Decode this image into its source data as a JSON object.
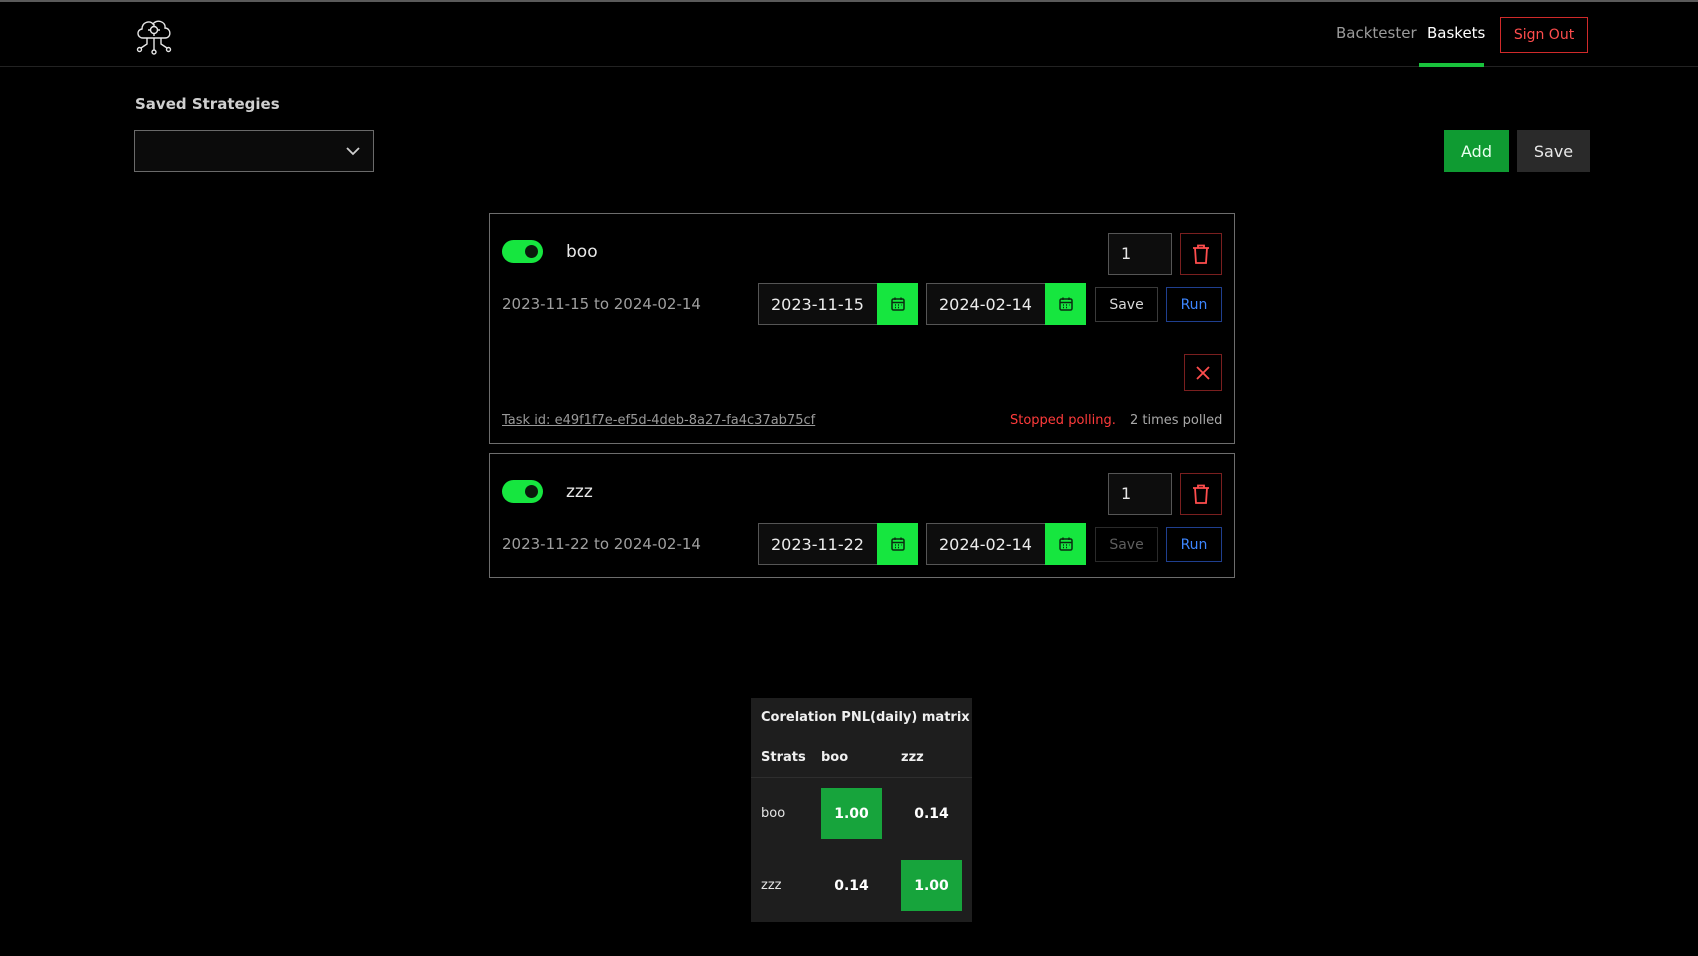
{
  "nav": {
    "links": [
      "Backtester",
      "Baskets"
    ],
    "active": "Baskets",
    "sign_out": "Sign Out"
  },
  "controls": {
    "saved_strategies_label": "Saved Strategies",
    "saved_strategies_value": "",
    "add_label": "Add",
    "save_label": "Save"
  },
  "strategies": [
    {
      "name": "boo",
      "enabled": true,
      "weight": "1",
      "range_text": "2023-11-15 to 2024-02-14",
      "start_date": "2023-11-15",
      "end_date": "2024-02-14",
      "save_label": "Save",
      "run_label": "Run",
      "task_id": "Task id: e49f1f7e-ef5d-4deb-8a27-fa4c37ab75cf",
      "status": "Stopped polling.",
      "poll_count": "2 times polled"
    },
    {
      "name": "zzz",
      "enabled": true,
      "weight": "1",
      "range_text": "2023-11-22 to 2024-02-14",
      "start_date": "2023-11-22",
      "end_date": "2024-02-14",
      "save_label": "Save",
      "run_label": "Run"
    }
  ],
  "matrix": {
    "title": "Corelation PNL(daily) matrix",
    "corner_header": "Strats",
    "columns": [
      "boo",
      "zzz"
    ],
    "rows": [
      {
        "label": "boo",
        "values": [
          "1.00",
          "0.14"
        ]
      },
      {
        "label": "zzz",
        "values": [
          "0.14",
          "1.00"
        ]
      }
    ]
  },
  "colors": {
    "accent_green": "#16e63f",
    "add_green": "#0f9b32",
    "danger_red": "#ff3b3b",
    "run_blue": "#3d86ff"
  },
  "icons": [
    "cloud-network-logo-icon",
    "chevron-down-icon",
    "trash-icon",
    "calendar-icon",
    "close-icon"
  ]
}
